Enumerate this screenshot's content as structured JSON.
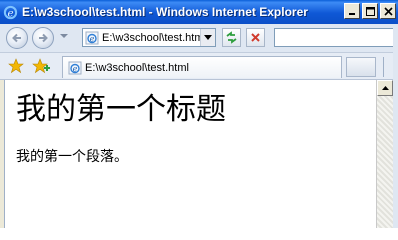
{
  "window": {
    "title": "E:\\w3school\\test.html - Windows Internet Explorer",
    "icon": "ie-icon"
  },
  "address_bar": {
    "value": "E:\\w3school\\test.html"
  },
  "search": {
    "value": ""
  },
  "tab": {
    "label": "E:\\w3school\\test.html"
  },
  "page": {
    "heading": "我的第一个标题",
    "paragraph": "我的第一个段落。"
  },
  "colors": {
    "titlebar": "#0b4fc8",
    "favorites_star": "#f2b705",
    "refresh_green": "#2e9e3e",
    "stop_red": "#d03a2c"
  }
}
